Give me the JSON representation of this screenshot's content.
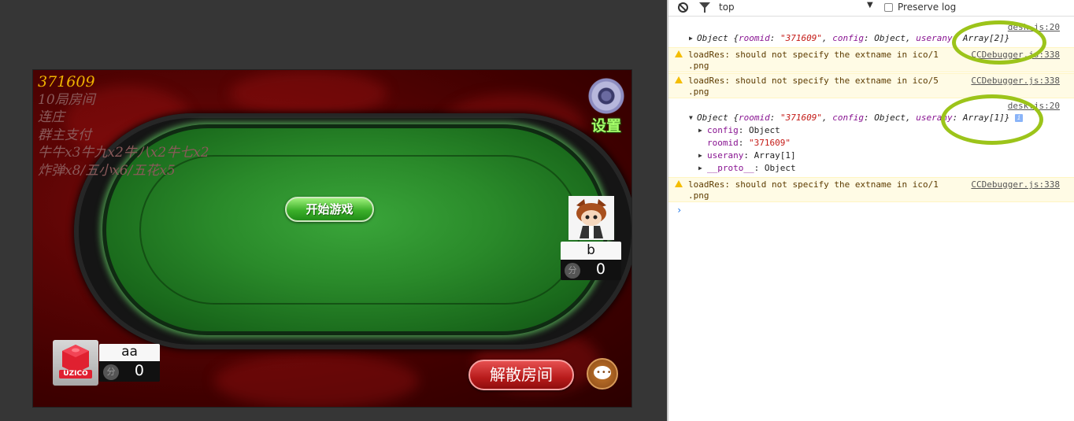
{
  "game": {
    "room_id": "371609",
    "room_lines": [
      "10局房间",
      "连庄",
      "群主支付",
      "牛牛x3牛九x2牛八x2牛七x2",
      "炸弹x8/五小x6/五花x5"
    ],
    "settings_label": "设置",
    "start_button": "开始游戏",
    "dismiss_button": "解散房间",
    "fen_label": "分",
    "players": [
      {
        "name": "b",
        "score": "0",
        "avatar": "cartoon-avatar"
      },
      {
        "name": "aa",
        "score": "0",
        "avatar": "uzico-logo",
        "avatar_text": "UZICO"
      }
    ]
  },
  "devtools": {
    "context": "top",
    "preserve_log_label": "Preserve log",
    "preserve_log_checked": false,
    "messages": [
      {
        "source": "desk.js:20",
        "text_prefix": "Object {",
        "roomid_key": "roomid",
        "roomid_val": "\"371609\"",
        "config_key": "config",
        "config_val": "Object",
        "userany_key": "userany",
        "userany_val": "Array[2]}"
      },
      {
        "level": "warning",
        "line1": "loadRes: should not specify the extname in ico/1",
        "line2": ".png",
        "source": "CCDebugger.js:338"
      },
      {
        "level": "warning",
        "line1": "loadRes: should not specify the extname in ico/5",
        "line2": ".png",
        "source": "CCDebugger.js:338"
      },
      {
        "source": "desk.js:20",
        "text_prefix": "Object {",
        "roomid_key": "roomid",
        "roomid_val": "\"371609\"",
        "config_key": "config",
        "config_val": "Object",
        "userany_key": "userany",
        "userany_val": "Array[1]}",
        "expanded": [
          {
            "key": "config",
            "val": "Object"
          },
          {
            "key": "roomid",
            "val": "\"371609\""
          },
          {
            "key": "userany",
            "val": "Array[1]"
          },
          {
            "key": "__proto__",
            "val": "Object"
          }
        ]
      },
      {
        "level": "warning",
        "line1": "loadRes: should not specify the extname in ico/1",
        "line2": ".png",
        "source": "CCDebugger.js:338"
      }
    ],
    "prompt": "›",
    "annotation_color": "#9cc41a"
  }
}
